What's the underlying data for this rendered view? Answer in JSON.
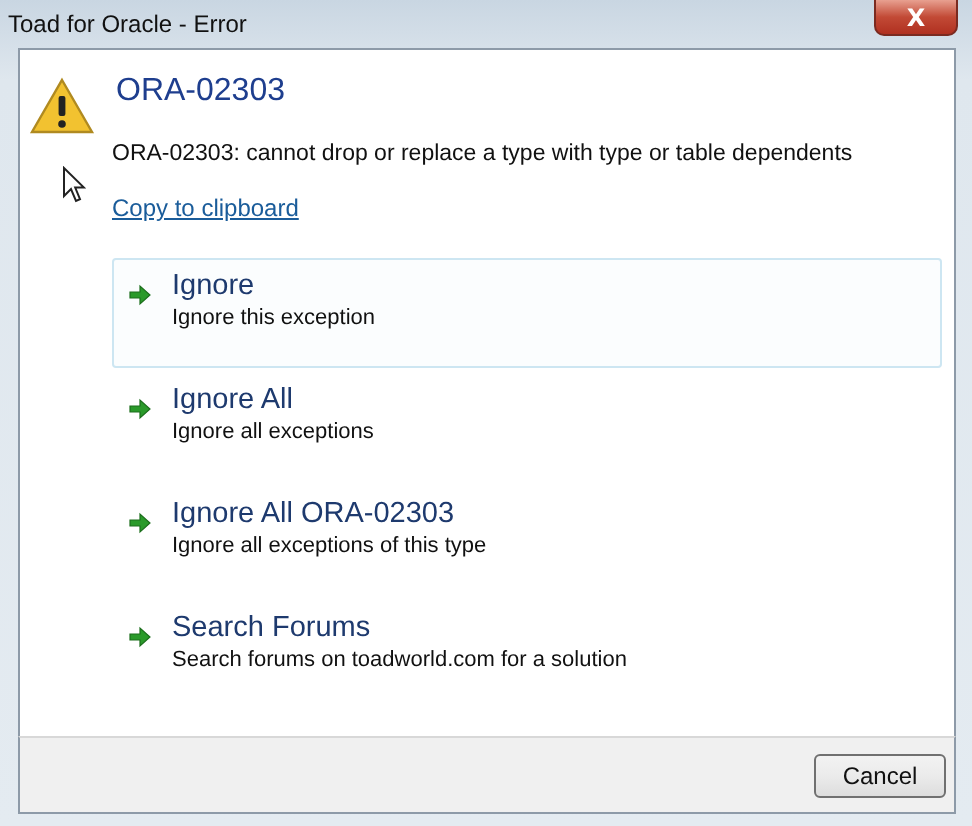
{
  "window": {
    "title": "Toad for Oracle - Error",
    "close_label": "X"
  },
  "error": {
    "code": "ORA-02303",
    "message": "ORA-02303: cannot drop or replace a type with type or table dependents",
    "copy_link": "Copy to clipboard"
  },
  "options": [
    {
      "title": "Ignore",
      "description": "Ignore this exception",
      "highlighted": true
    },
    {
      "title": "Ignore All",
      "description": "Ignore all exceptions",
      "highlighted": false
    },
    {
      "title": "Ignore All ORA-02303",
      "description": "Ignore all exceptions of this type",
      "highlighted": false
    },
    {
      "title": "Search Forums",
      "description": "Search forums on toadworld.com for a solution",
      "highlighted": false
    }
  ],
  "buttons": [
    "Cancel"
  ]
}
